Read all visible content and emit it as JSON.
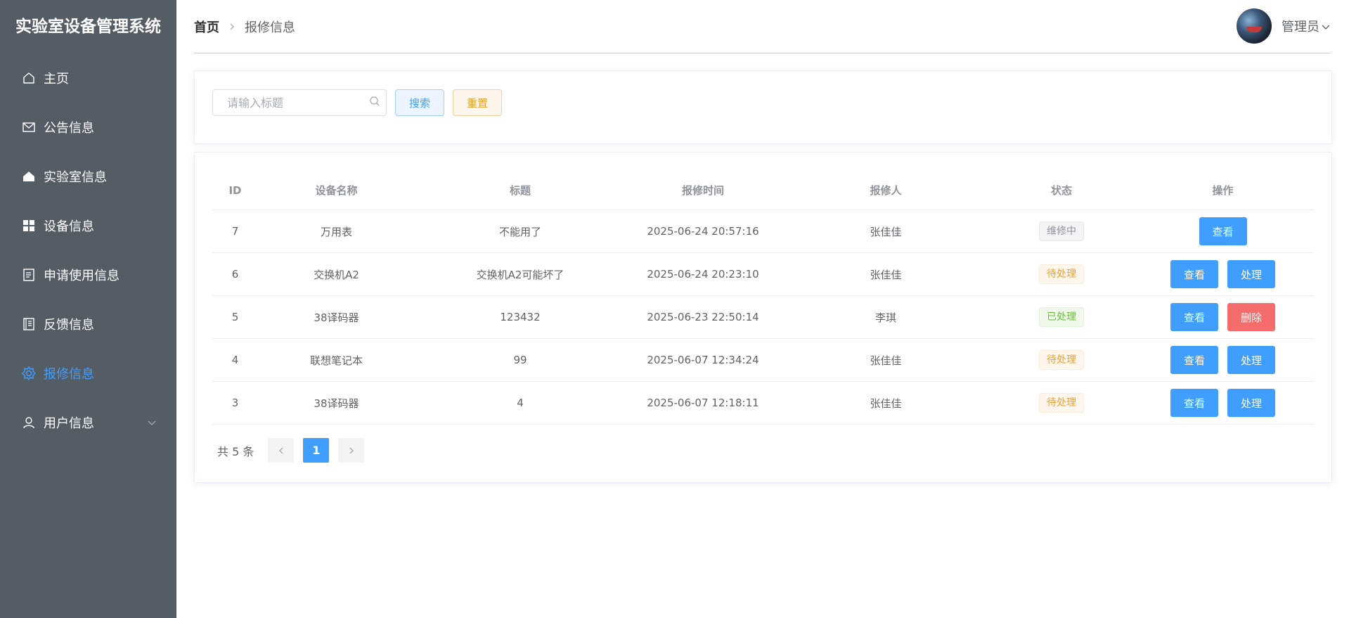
{
  "app": {
    "title": "实验室设备管理系统"
  },
  "sidebar": {
    "items": [
      {
        "label": "主页",
        "icon": "home-icon"
      },
      {
        "label": "公告信息",
        "icon": "message-icon"
      },
      {
        "label": "实验室信息",
        "icon": "house-icon"
      },
      {
        "label": "设备信息",
        "icon": "grid-icon"
      },
      {
        "label": "申请使用信息",
        "icon": "document-icon"
      },
      {
        "label": "反馈信息",
        "icon": "notebook-icon"
      },
      {
        "label": "报修信息",
        "icon": "setting-icon",
        "active": true
      },
      {
        "label": "用户信息",
        "icon": "user-icon",
        "expandable": true
      }
    ]
  },
  "header": {
    "breadcrumb": {
      "home": "首页",
      "current": "报修信息"
    },
    "user": {
      "name": "管理员"
    }
  },
  "search": {
    "placeholder": "请输入标题",
    "value": "",
    "search_label": "搜索",
    "reset_label": "重置"
  },
  "table": {
    "columns": [
      "ID",
      "设备名称",
      "标题",
      "报修时间",
      "报修人",
      "状态",
      "操作"
    ],
    "rows": [
      {
        "id": "7",
        "device": "万用表",
        "title": "不能用了",
        "time": "2025-06-24 20:57:16",
        "reporter": "张佳佳",
        "status": "维修中",
        "status_type": "info",
        "actions": [
          "查看"
        ]
      },
      {
        "id": "6",
        "device": "交换机A2",
        "title": "交换机A2可能坏了",
        "time": "2025-06-24 20:23:10",
        "reporter": "张佳佳",
        "status": "待处理",
        "status_type": "warning",
        "actions": [
          "查看",
          "处理"
        ]
      },
      {
        "id": "5",
        "device": "38译码器",
        "title": "123432",
        "time": "2025-06-23 22:50:14",
        "reporter": "李琪",
        "status": "已处理",
        "status_type": "success",
        "actions": [
          "查看",
          "删除"
        ]
      },
      {
        "id": "4",
        "device": "联想笔记本",
        "title": "99",
        "time": "2025-06-07 12:34:24",
        "reporter": "张佳佳",
        "status": "待处理",
        "status_type": "warning",
        "actions": [
          "查看",
          "处理"
        ]
      },
      {
        "id": "3",
        "device": "38译码器",
        "title": "4",
        "time": "2025-06-07 12:18:11",
        "reporter": "张佳佳",
        "status": "待处理",
        "status_type": "warning",
        "actions": [
          "查看",
          "处理"
        ]
      }
    ]
  },
  "pagination": {
    "total_text": "共 5 条",
    "current_page": "1"
  },
  "colors": {
    "sidebar_bg": "#545c64",
    "active": "#409eff",
    "primary": "#409eff",
    "danger": "#f56c6c",
    "warning": "#e6a23c",
    "success": "#67c23a"
  }
}
